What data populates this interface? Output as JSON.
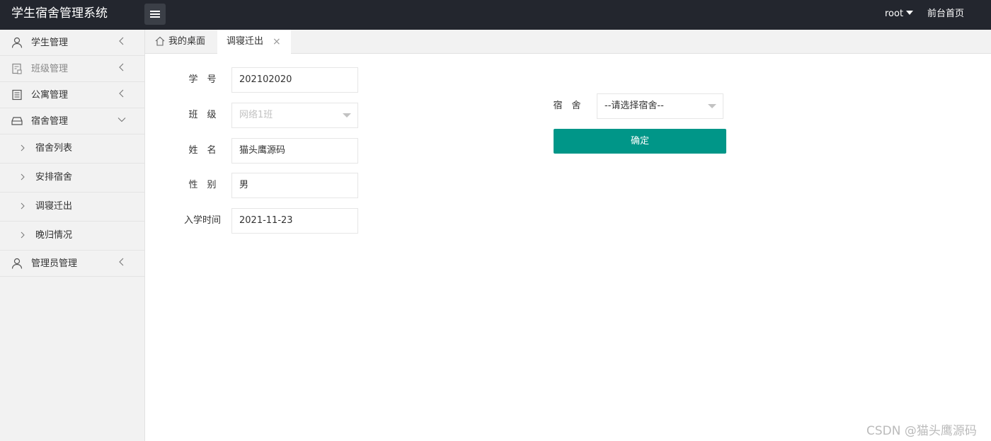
{
  "header": {
    "app_title": "学生宿舍管理系统",
    "user_name": "root",
    "home_link": "前台首页"
  },
  "sidebar": {
    "items": [
      {
        "label": "学生管理",
        "icon": "user-icon"
      },
      {
        "label": "班级管理",
        "icon": "class-icon"
      },
      {
        "label": "公寓管理",
        "icon": "apartment-icon"
      },
      {
        "label": "宿舍管理",
        "icon": "bed-icon"
      },
      {
        "label": "管理员管理",
        "icon": "admin-icon"
      }
    ],
    "sub_items": [
      {
        "label": "宿舍列表"
      },
      {
        "label": "安排宿舍"
      },
      {
        "label": "调寝迁出"
      },
      {
        "label": "晚归情况"
      }
    ]
  },
  "tabs": {
    "home_label": "我的桌面",
    "active_label": "调寝迁出",
    "close_glyph": "×"
  },
  "form": {
    "student_id": {
      "label": "学　号",
      "value": "202102020"
    },
    "class": {
      "label": "班　级",
      "value": "网络1班"
    },
    "name": {
      "label": "姓　名",
      "value": "猫头鹰源码"
    },
    "gender": {
      "label": "性　别",
      "value": "男"
    },
    "enroll_date": {
      "label": "入学时间",
      "value": "2021-11-23"
    }
  },
  "dorm": {
    "label": "宿　舍",
    "selected": "--请选择宿舍--"
  },
  "confirm_label": "确定",
  "watermark": "CSDN @猫头鹰源码",
  "colors": {
    "header_bg": "#23262e",
    "accent": "#009688",
    "sidebar_bg": "#f2f2f2"
  }
}
